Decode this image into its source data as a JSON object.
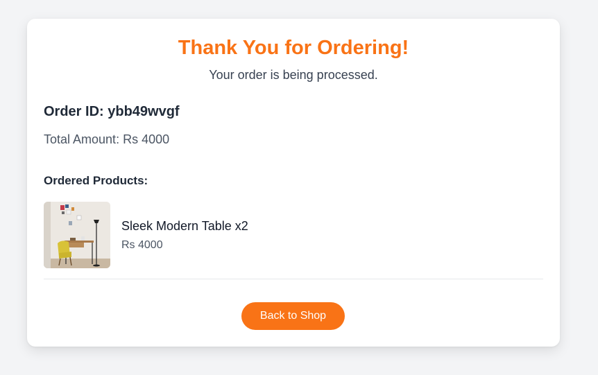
{
  "confirmation": {
    "title": "Thank You for Ordering!",
    "subtitle": "Your order is being processed.",
    "order_id_text": "Order ID: ybb49wvgf",
    "total_text": "Total Amount: Rs 4000",
    "products_heading": "Ordered Products:"
  },
  "products": [
    {
      "name": "Sleek Modern Table x2",
      "price": "Rs 4000",
      "image_icon": "product-photo-desk-with-yellow-chair"
    }
  ],
  "actions": {
    "back_label": "Back to Shop"
  },
  "colors": {
    "accent": "#f97316",
    "background": "#f3f4f6",
    "card": "#ffffff"
  }
}
